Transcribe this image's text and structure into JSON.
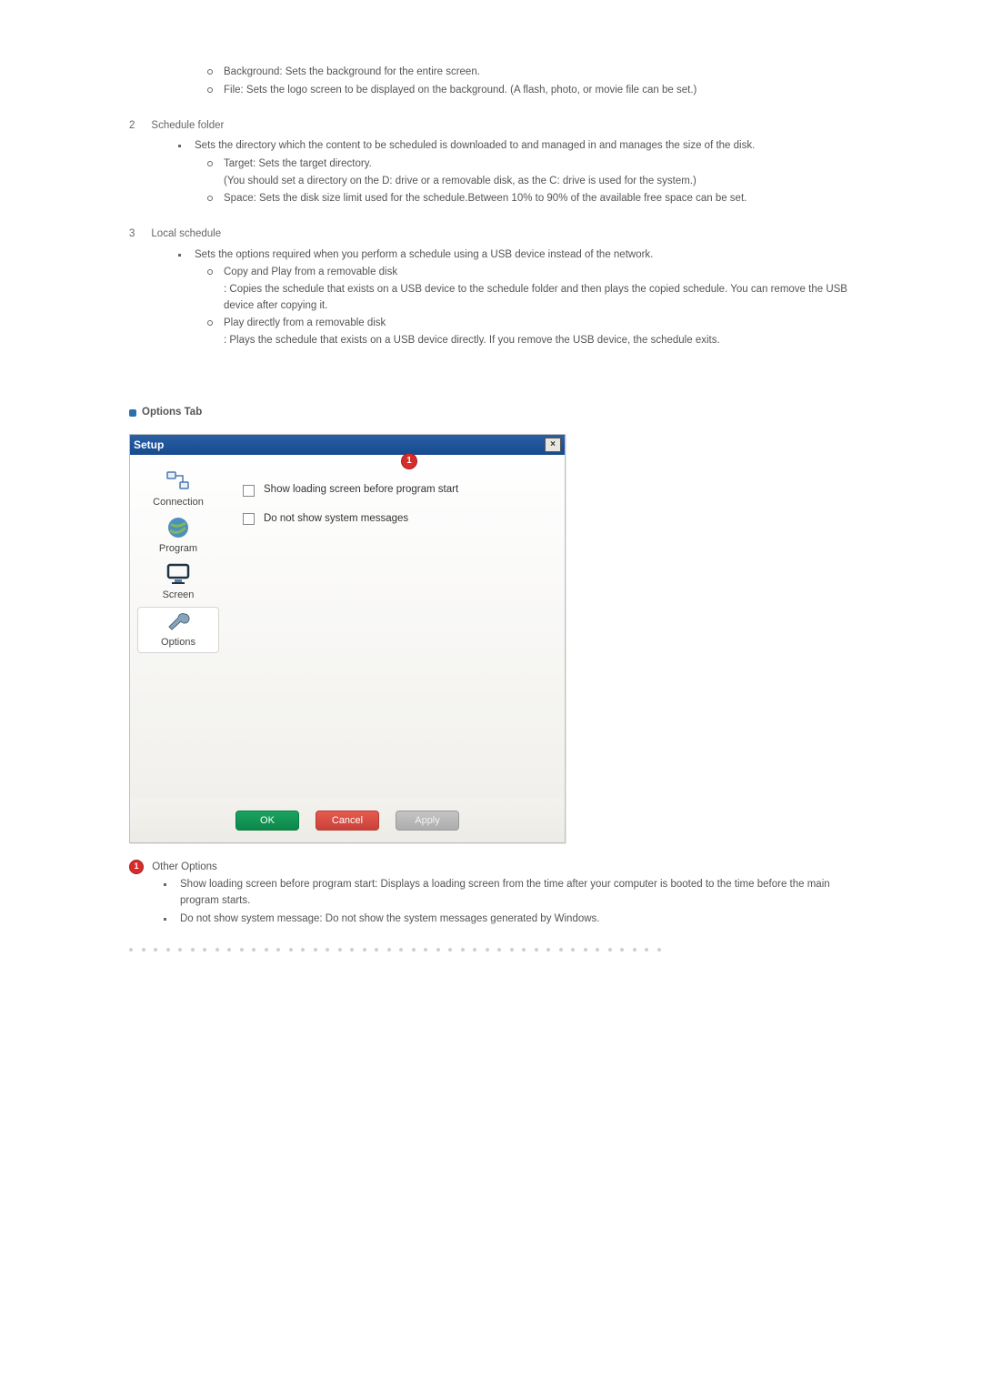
{
  "pre_items": {
    "background": "Background: Sets the background for the entire screen.",
    "file": "File: Sets the logo screen to be displayed on the background. (A flash, photo, or movie file can be set.)"
  },
  "section2": {
    "num": "2",
    "title": "Schedule folder",
    "bullet": "Sets the directory which the content to be scheduled is downloaded to and managed in and manages the size of the disk.",
    "sub1_a": "Target: Sets the target directory.",
    "sub1_b": "(You should set a directory on the D: drive or a removable disk, as the C: drive is used for the system.)",
    "sub2": "Space: Sets the disk size limit used for the schedule.Between 10% to 90% of the available free space can be set."
  },
  "section3": {
    "num": "3",
    "title": "Local schedule",
    "bullet": "Sets the options required when you perform a schedule using a USB device instead of the network.",
    "sub1_a": "Copy and Play from a removable disk",
    "sub1_b": ": Copies the schedule that exists on a USB device to the schedule folder and then plays the copied schedule. You can remove the USB device after copying it.",
    "sub2_a": "Play directly from a removable disk",
    "sub2_b": ": Plays the schedule that exists on a USB device directly. If you remove the USB device, the schedule exits."
  },
  "options_tab_label": "Options Tab",
  "dialog": {
    "title": "Setup",
    "close": "×",
    "callout": "1",
    "sidebar": {
      "connection": "Connection",
      "program": "Program",
      "screen": "Screen",
      "options": "Options"
    },
    "check1": "Show loading screen before program start",
    "check2": "Do not show system messages",
    "buttons": {
      "ok": "OK",
      "cancel": "Cancel",
      "apply": "Apply"
    }
  },
  "other_options": {
    "callout": "1",
    "title": "Other Options",
    "b1": "Show loading screen before program start: Displays a loading screen from the time after your computer is booted to the time before the main program starts.",
    "b2": "Do not show system message: Do not show the system messages generated by Windows."
  }
}
